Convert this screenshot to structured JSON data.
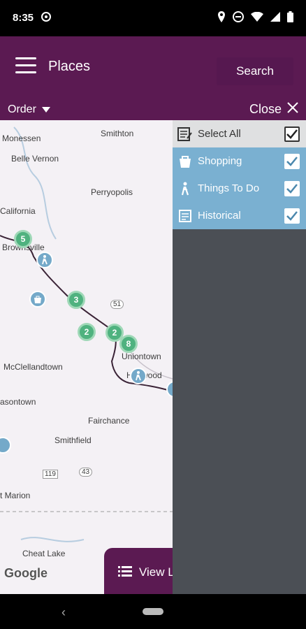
{
  "status": {
    "time": "8:35"
  },
  "header": {
    "title": "Places",
    "search_label": "Search"
  },
  "toolbar": {
    "order_label": "Order",
    "close_label": "Close"
  },
  "map": {
    "labels": [
      {
        "text": "Monessen"
      },
      {
        "text": "Smithton"
      },
      {
        "text": "Belle Vernon"
      },
      {
        "text": "Perryopolis"
      },
      {
        "text": "California"
      },
      {
        "text": "Brownsville"
      },
      {
        "text": "Uniontown"
      },
      {
        "text": "McClellandtown"
      },
      {
        "text": "Hopwood"
      },
      {
        "text": "asontown"
      },
      {
        "text": "Fairchance"
      },
      {
        "text": "Smithfield"
      },
      {
        "text": "t Marion"
      },
      {
        "text": "Cheat Lake"
      },
      {
        "text": "51"
      },
      {
        "text": "119"
      },
      {
        "text": "43"
      }
    ],
    "clusters": [
      "5",
      "3",
      "2",
      "2",
      "8"
    ],
    "google": "Google",
    "view_list_label": "View L"
  },
  "filters": {
    "select_all": "Select All",
    "categories": [
      {
        "label": "Shopping",
        "icon": "shopping-bag-icon",
        "checked": true
      },
      {
        "label": "Things To Do",
        "icon": "walking-person-icon",
        "checked": true
      },
      {
        "label": "Historical",
        "icon": "historical-marker-icon",
        "checked": true
      }
    ]
  },
  "colors": {
    "brand": "#5b1a52",
    "panel": "#4b4f55",
    "category": "#7ab0d1",
    "cluster": "#4fb27f"
  }
}
